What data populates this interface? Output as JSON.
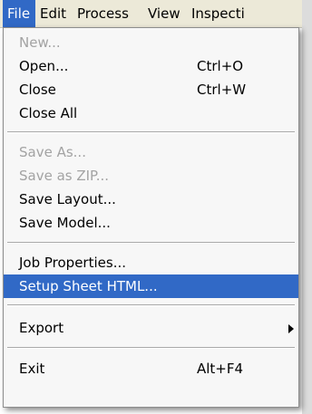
{
  "menubar": {
    "file": "File",
    "edit": "Edit",
    "process": "Process",
    "view": "View",
    "inspection": "Inspecti"
  },
  "menu": {
    "new": "New...",
    "open": "Open...",
    "open_shortcut": "Ctrl+O",
    "close": "Close",
    "close_shortcut": "Ctrl+W",
    "close_all": "Close All",
    "save_as": "Save As...",
    "save_as_zip": "Save as ZIP...",
    "save_layout": "Save Layout...",
    "save_model": "Save Model...",
    "job_properties": "Job Properties...",
    "setup_sheet_html": "Setup Sheet HTML...",
    "export": "Export",
    "exit": "Exit",
    "exit_shortcut": "Alt+F4"
  },
  "colors": {
    "highlight": "#3169c6",
    "disabled_text": "#a3a3a3",
    "menu_bg": "#f7f7f7"
  }
}
